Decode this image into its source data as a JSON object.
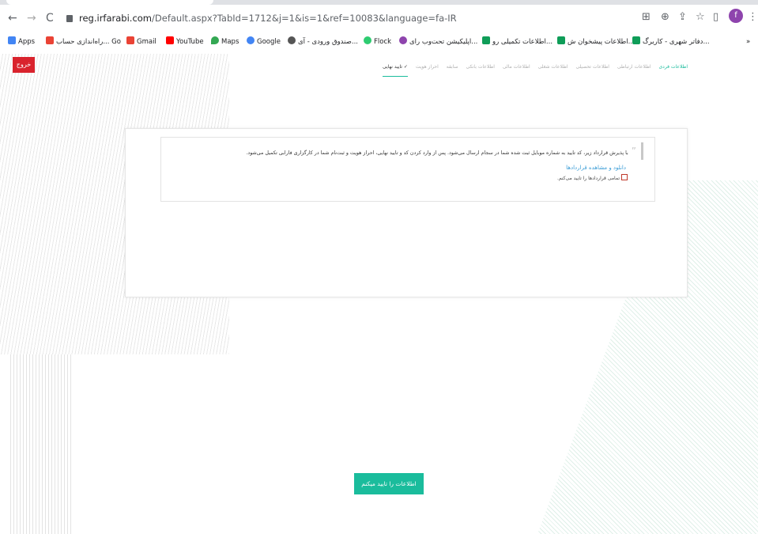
{
  "browser": {
    "url_host": "reg.irfarabi.com",
    "url_rest": "/Default.aspx?TabId=1712&j=1&is=1&ref=10083&language=fa-IR",
    "profile_initial": "f",
    "bookmarks": [
      "Apps",
      "راه‌اندازی حساب... Go",
      "Gmail",
      "YouTube",
      "Maps",
      "Google",
      "صندوق ورودی - آی...",
      "Flock",
      "اپلیکیشن تحت‌وب رای...",
      "اطلاعات تکمیلی رو...",
      "اطلاعات پیشخوان ش...",
      "دفاتر شهری - کاربرگ..."
    ],
    "bookmarks_more": "»"
  },
  "page": {
    "exit_label": "خروج",
    "steps": [
      "اطلاعات فردی",
      "اطلاعات ارتباطی",
      "اطلاعات تحصیلی",
      "اطلاعات شغلی",
      "اطلاعات مالی",
      "اطلاعات بانکی",
      "سابقه",
      "احراز هویت",
      "تایید نهایی"
    ],
    "notice": "با پذیرش قرارداد زیر، کد تایید به شماره موبایل ثبت شده شما در سجام ارسال می‌شود. پس از وارد کردن کد و تایید نهایی، احراز هویت و ثبت‌نام شما در کارگزاری فارابی تکمیل می‌شود.",
    "download_link": "دانلود و مشاهده قراردادها",
    "agree_label": "تمامی قراردادها را تایید می‌کنم.",
    "confirm_button": "اطلاعات را تایید میکنم"
  },
  "colors": {
    "accent": "#1abc9c",
    "exit": "#d9232d",
    "link": "#3b9dd6"
  }
}
